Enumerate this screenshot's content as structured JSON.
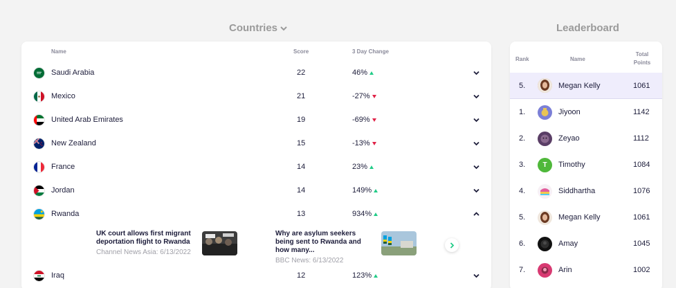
{
  "countries_title": "Countries",
  "leaderboard_title": "Leaderboard",
  "table_headers": {
    "name": "Name",
    "score": "Score",
    "change": "3 Day Change"
  },
  "countries": [
    {
      "name": "Saudi Arabia",
      "score": "22",
      "change": "46%",
      "direction": "up"
    },
    {
      "name": "Mexico",
      "score": "21",
      "change": "-27%",
      "direction": "down"
    },
    {
      "name": "United Arab Emirates",
      "score": "19",
      "change": "-69%",
      "direction": "down"
    },
    {
      "name": "New Zealand",
      "score": "15",
      "change": "-13%",
      "direction": "down"
    },
    {
      "name": "France",
      "score": "14",
      "change": "23%",
      "direction": "up"
    },
    {
      "name": "Jordan",
      "score": "14",
      "change": "149%",
      "direction": "up"
    },
    {
      "name": "Rwanda",
      "score": "13",
      "change": "934%",
      "direction": "up",
      "expanded": true
    },
    {
      "name": "Iraq",
      "score": "12",
      "change": "123%",
      "direction": "up"
    }
  ],
  "news": [
    {
      "headline": "UK court allows first migrant deportation flight to Rwanda",
      "source": "Channel News Asia: 6/13/2022"
    },
    {
      "headline": "Why are asylum seekers being sent to Rwanda and how many...",
      "source": "BBC News: 6/13/2022"
    }
  ],
  "leaderboard_headers": {
    "rank": "Rank",
    "name": "Name",
    "points_line1": "Total",
    "points_line2": "Points"
  },
  "leaderboard": [
    {
      "rank": "5.",
      "name": "Megan Kelly",
      "points": "1061",
      "current_user": true,
      "avatar": "photo-avatar"
    },
    {
      "rank": "1.",
      "name": "Jiyoon",
      "points": "1142",
      "avatar": "photo-avatar"
    },
    {
      "rank": "2.",
      "name": "Zeyao",
      "points": "1112",
      "avatar": "photo-avatar"
    },
    {
      "rank": "3.",
      "name": "Timothy",
      "points": "1084",
      "avatar": "initial-avatar",
      "initial": "T"
    },
    {
      "rank": "4.",
      "name": "Siddhartha",
      "points": "1076",
      "avatar": "photo-avatar"
    },
    {
      "rank": "5.",
      "name": "Megan Kelly",
      "points": "1061",
      "avatar": "photo-avatar"
    },
    {
      "rank": "6.",
      "name": "Amay",
      "points": "1045",
      "avatar": "photo-avatar"
    },
    {
      "rank": "7.",
      "name": "Arin",
      "points": "1002",
      "avatar": "photo-avatar"
    }
  ],
  "colors": {
    "up": "#22cc88",
    "down": "#e02247",
    "highlight": "#efedfc",
    "text": "#1c1c3a"
  }
}
